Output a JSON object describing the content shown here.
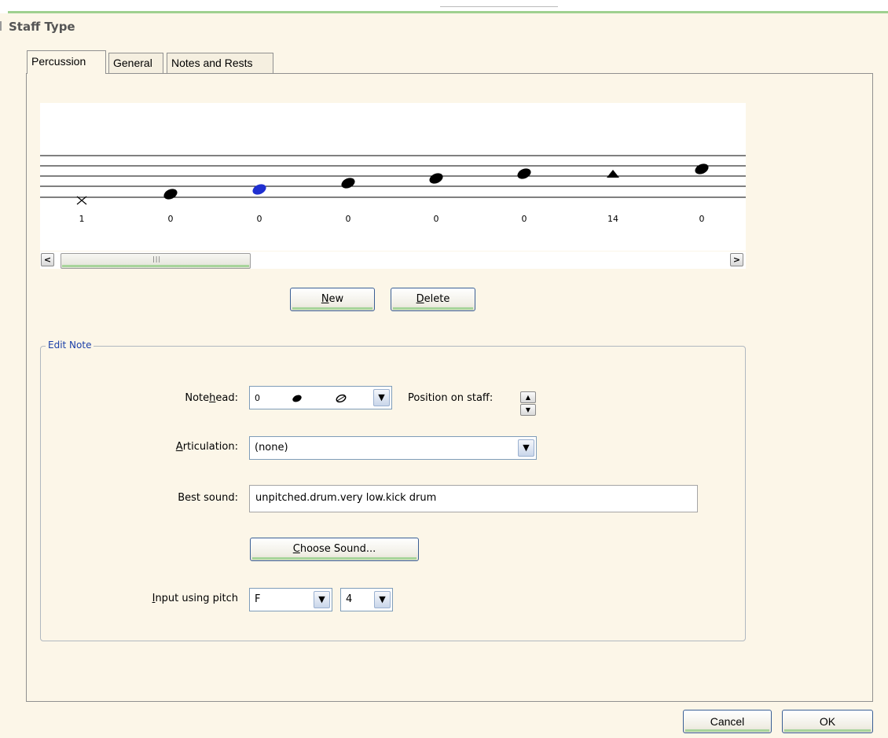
{
  "window": {
    "title": "Staff Type"
  },
  "tabs": [
    {
      "label": "Percussion",
      "active": true
    },
    {
      "label": "General",
      "active": false
    },
    {
      "label": "Notes and Rests",
      "active": false
    }
  ],
  "staff": {
    "note_labels": [
      "1",
      "0",
      "0",
      "0",
      "0",
      "0",
      "14",
      "0"
    ],
    "note_shapes": [
      "cross",
      "filled",
      "filled-selected",
      "filled",
      "filled",
      "filled",
      "triangle",
      "filled"
    ],
    "selected_color": "#1f2fd0"
  },
  "scrollbar": {
    "left_label": "<",
    "right_label": ">",
    "grip_label": "|||"
  },
  "buttons": {
    "new_access": "N",
    "new_rest": "ew",
    "delete_access": "D",
    "delete_rest": "elete"
  },
  "edit_note": {
    "legend": "Edit Note",
    "notehead_label_pre": "Note",
    "notehead_label_access": "h",
    "notehead_label_post": "ead:",
    "notehead_value": "0",
    "position_label": "Position on staff:",
    "articulation_label_access": "A",
    "articulation_label_post": "rticulation:",
    "articulation_value": "(none)",
    "best_sound_label": "Best sound:",
    "best_sound_value": "unpitched.drum.very low.kick drum",
    "choose_sound_access": "C",
    "choose_sound_rest": "hoose Sound...",
    "input_pitch_access": "I",
    "input_pitch_rest": "nput using pitch",
    "pitch_value": "F",
    "octave_value": "4"
  },
  "footer": {
    "cancel_label": "Cancel",
    "ok_label": "OK"
  },
  "colors": {
    "background": "#fcf6e8",
    "accent_green": "#a7d49b",
    "legend_blue": "#1a3fa8"
  }
}
